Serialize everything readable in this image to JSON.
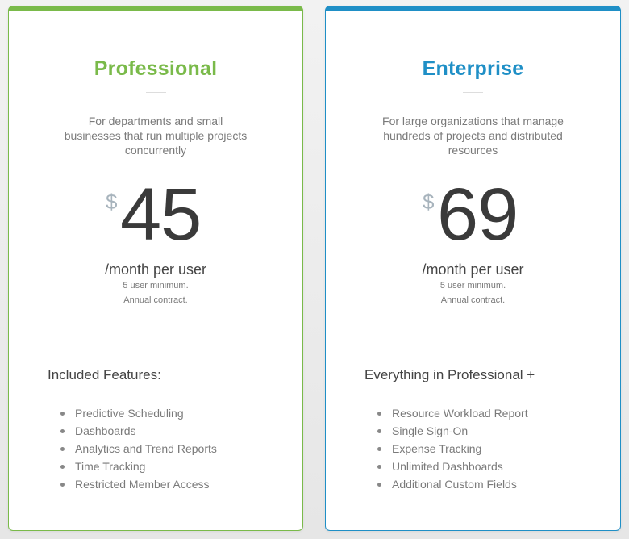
{
  "colors": {
    "professional": "#7aba4a",
    "enterprise": "#1f8fc6"
  },
  "plans": [
    {
      "name": "Professional",
      "description": "For departments and small businesses that run multiple projects concurrently",
      "currency": "$",
      "price": "45",
      "period": "/month per user",
      "note_1": "5 user minimum.",
      "note_2": "Annual contract.",
      "features_heading": "Included Features:",
      "features": [
        "Predictive Scheduling",
        "Dashboards",
        "Analytics and Trend Reports",
        "Time Tracking",
        "Restricted Member Access"
      ]
    },
    {
      "name": "Enterprise",
      "description": "For large organizations that manage hundreds of projects and distributed resources",
      "currency": "$",
      "price": "69",
      "period": "/month per user",
      "note_1": "5 user minimum.",
      "note_2": "Annual contract.",
      "features_heading": "Everything in Professional +",
      "features": [
        "Resource Workload Report",
        "Single Sign-On",
        "Expense Tracking",
        "Unlimited Dashboards",
        "Additional Custom Fields"
      ]
    }
  ]
}
